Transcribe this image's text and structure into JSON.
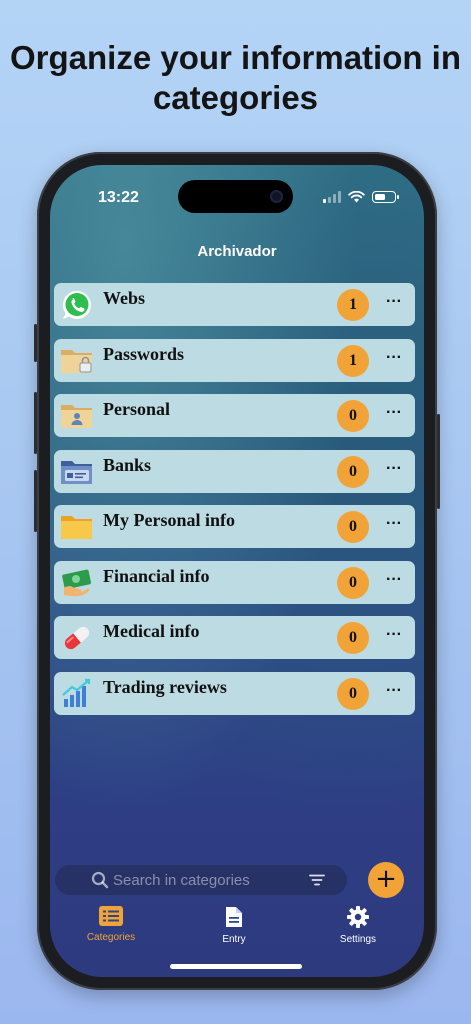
{
  "promo": {
    "headline": "Organize your information in categories"
  },
  "status_bar": {
    "time": "13:22",
    "battery_level": 0.55
  },
  "app": {
    "title": "Archivador"
  },
  "categories": [
    {
      "label": "Webs",
      "count": "1",
      "icon": "whatsapp-icon"
    },
    {
      "label": "Passwords",
      "count": "1",
      "icon": "folder-lock-icon"
    },
    {
      "label": "Personal",
      "count": "0",
      "icon": "folder-user-icon"
    },
    {
      "label": "Banks",
      "count": "0",
      "icon": "card-folder-icon"
    },
    {
      "label": "My Personal info",
      "count": "0",
      "icon": "folder-icon"
    },
    {
      "label": "Financial info",
      "count": "0",
      "icon": "money-icon"
    },
    {
      "label": "Medical info",
      "count": "0",
      "icon": "pill-icon"
    },
    {
      "label": "Trading reviews",
      "count": "0",
      "icon": "chart-icon"
    }
  ],
  "row_more_label": "···",
  "search": {
    "placeholder": "Search in categories"
  },
  "fab_label": "+",
  "tabs": [
    {
      "label": "Categories",
      "icon": "list-icon",
      "active": true
    },
    {
      "label": "Entry",
      "icon": "document-icon",
      "active": false
    },
    {
      "label": "Settings",
      "icon": "gear-icon",
      "active": false
    }
  ],
  "colors": {
    "accent": "#f1a338",
    "row": "#bcdbe2",
    "background": "#a7c6f1"
  }
}
